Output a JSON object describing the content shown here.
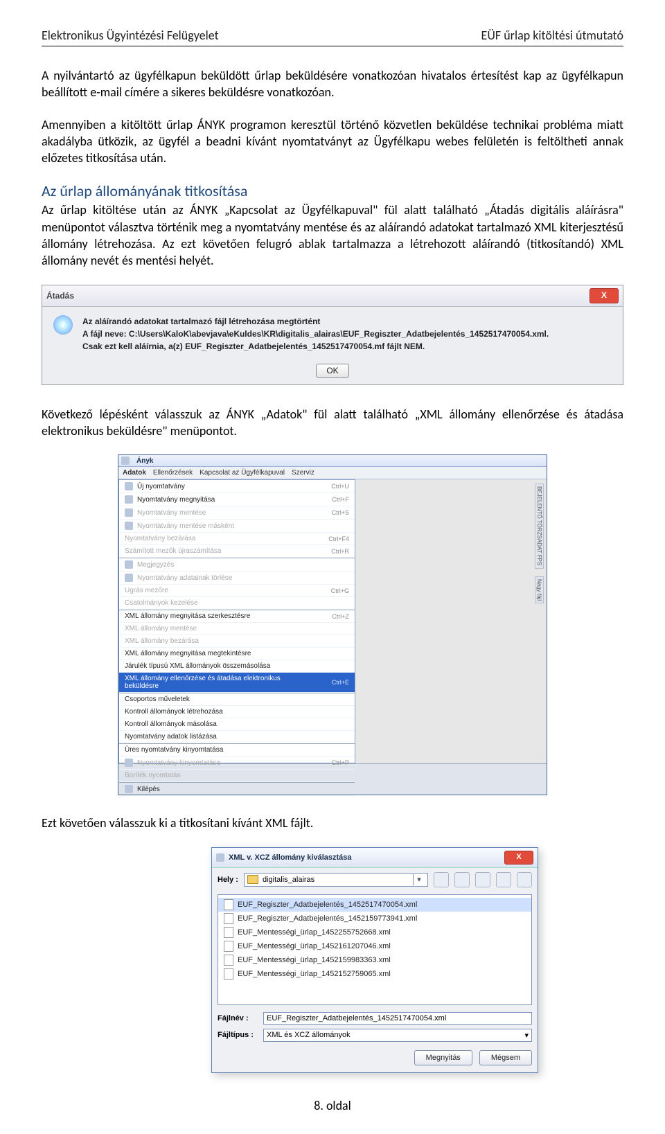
{
  "header": {
    "left": "Elektronikus Ügyintézési Felügyelet",
    "right": "EÜF űrlap kitöltési útmutató"
  },
  "p1": "A nyilvántartó az ügyfélkapun beküldött űrlap beküldésére vonatkozóan hivatalos értesítést kap az ügyfélkapun beállított e-mail címére a sikeres beküldésre vonatkozóan.",
  "p2": "Amennyiben a kitöltött űrlap ÁNYK programon keresztül történő közvetlen beküldése technikai probléma miatt akadályba ütközik, az ügyfél a beadni kívánt nyomtatványt az Ügyfélkapu webes felületén is feltöltheti annak előzetes titkosítása után.",
  "h1": "Az űrlap állományának titkosítása",
  "p3": "Az űrlap kitöltése után az ÁNYK „Kapcsolat az Ügyfélkapuval\" fül alatt található „Átadás digitális aláírásra\" menüpontot választva történik meg a nyomtatvány mentése és az aláírandó adatokat tartalmazó XML kiterjesztésű állomány létrehozása. Az ezt követően felugró ablak tartalmazza a létrehozott aláírandó (titkosítandó) XML állomány nevét és mentési helyét.",
  "p4": "Következő lépésként válasszuk az ÁNYK „Adatok\" fül alatt található „XML állomány ellenőrzése és átadása elektronikus beküldésre\" menüpontot.",
  "p5": "Ezt követően válasszuk ki a titkosítani kívánt XML fájlt.",
  "footer": "8. oldal",
  "dlg1": {
    "title": "Átadás",
    "close": "X",
    "l1": "Az aláírandó adatokat tartalmazó fájl létrehozása megtörtént",
    "l2": "A fájl neve: C:\\Users\\KaloK\\abevjava\\eKuldes\\KR\\digitalis_alairas\\EUF_Regiszter_Adatbejelentés_1452517470054.xml.",
    "l3": "Csak ezt kell aláírnia, a(z) EUF_Regiszter_Adatbejelentés_1452517470054.mf fájlt NEM.",
    "ok": "OK"
  },
  "anyk": {
    "apptitle": "Ányk",
    "menubar": [
      "Adatok",
      "Ellenőrzések",
      "Kapcsolat az Ügyfélkapuval",
      "Szerviz"
    ],
    "side1": "BEJELENTŐ TÖRZSADAT FPS",
    "side2": "Nagy fájl",
    "items": [
      {
        "ic": 1,
        "label": "Új nyomtatvány",
        "sc": "Ctrl+U"
      },
      {
        "ic": 1,
        "label": "Nyomtatvány megnyitása",
        "sc": "Ctrl+F"
      },
      {
        "ic": 1,
        "label": "Nyomtatvány mentése",
        "sc": "Ctrl+S",
        "disabled": true
      },
      {
        "ic": 1,
        "label": "Nyomtatvány mentése másként",
        "sc": "",
        "disabled": true
      },
      {
        "ic": 0,
        "label": "Nyomtatvány bezárása",
        "sc": "Ctrl+F4",
        "disabled": true
      },
      {
        "ic": 0,
        "label": "Számított mezők újraszámítása",
        "sc": "Ctrl+R",
        "disabled": true
      },
      {
        "ic": 1,
        "label": "Megjegyzés",
        "sc": "",
        "section": true,
        "disabled": true
      },
      {
        "ic": 1,
        "label": "Nyomtatvány adatainak törlése",
        "sc": "",
        "disabled": true
      },
      {
        "ic": 0,
        "label": "Ugrás mezőre",
        "sc": "Ctrl+G",
        "disabled": true
      },
      {
        "ic": 0,
        "label": "Csatolmányok kezelése",
        "sc": "",
        "disabled": true
      },
      {
        "ic": 0,
        "label": "XML állomány megnyitása szerkesztésre",
        "sc": "Ctrl+Z",
        "section": true
      },
      {
        "ic": 0,
        "label": "XML állomány mentése",
        "sc": "",
        "disabled": true
      },
      {
        "ic": 0,
        "label": "XML állomány bezárása",
        "sc": "",
        "disabled": true
      },
      {
        "ic": 0,
        "label": "XML állomány megnyitása megtekintésre",
        "sc": ""
      },
      {
        "ic": 0,
        "label": "Járulék típusú XML állományok összemásolása",
        "sc": ""
      },
      {
        "ic": 0,
        "label": "XML állomány ellenőrzése és átadása elektronikus beküldésre",
        "sc": "Ctrl+E",
        "selected": true
      },
      {
        "ic": 0,
        "label": "Csoportos műveletek",
        "sc": "",
        "section": true
      },
      {
        "ic": 0,
        "label": "Kontroll állományok létrehozása",
        "sc": ""
      },
      {
        "ic": 0,
        "label": "Kontroll állományok másolása",
        "sc": ""
      },
      {
        "ic": 0,
        "label": "Nyomtatvány adatok listázása",
        "sc": ""
      },
      {
        "ic": 0,
        "label": "Üres nyomtatvány kinyomtatása",
        "sc": "",
        "section": true
      },
      {
        "ic": 1,
        "label": "Nyomtatvány kinyomtatása",
        "sc": "Ctrl+P",
        "disabled": true
      },
      {
        "ic": 0,
        "label": "Boríték nyomtatás",
        "sc": "",
        "disabled": true
      },
      {
        "ic": 1,
        "label": "Kilépés",
        "sc": "",
        "section": true
      }
    ]
  },
  "fdlg": {
    "title": "XML v. XCZ állomány kiválasztása",
    "close": "X",
    "loc_label": "Hely :",
    "loc_value": "digitalis_alairas",
    "files": [
      "EUF_Regiszter_Adatbejelentés_1452517470054.xml",
      "EUF_Regiszter_Adatbejelentés_1452159773941.xml",
      "EUF_Mentességi_ürlap_1452255752668.xml",
      "EUF_Mentességi_ürlap_1452161207046.xml",
      "EUF_Mentességi_ürlap_1452159983363.xml",
      "EUF_Mentességi_ürlap_1452152759065.xml"
    ],
    "fname_label": "Fájlnév :",
    "fname_value": "EUF_Regiszter_Adatbejelentés_1452517470054.xml",
    "ftype_label": "Fájltípus :",
    "ftype_value": "XML és XCZ állományok",
    "open": "Megnyitás",
    "cancel": "Mégsem"
  }
}
